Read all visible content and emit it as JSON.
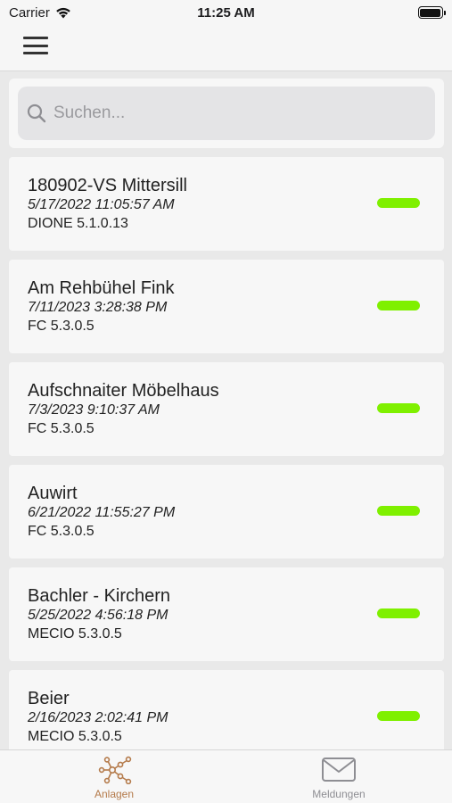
{
  "status_bar": {
    "carrier": "Carrier",
    "time": "11:25 AM"
  },
  "search": {
    "placeholder": "Suchen..."
  },
  "items": [
    {
      "name": "180902-VS Mittersill",
      "date": "5/17/2022 11:05:57 AM",
      "version": "DIONE 5.1.0.13",
      "status_color": "#7ff000"
    },
    {
      "name": "Am Rehbühel Fink",
      "date": "7/11/2023 3:28:38 PM",
      "version": "FC 5.3.0.5",
      "status_color": "#7ff000"
    },
    {
      "name": "Aufschnaiter Möbelhaus",
      "date": "7/3/2023 9:10:37 AM",
      "version": "FC 5.3.0.5",
      "status_color": "#7ff000"
    },
    {
      "name": "Auwirt",
      "date": "6/21/2022 11:55:27 PM",
      "version": "FC 5.3.0.5",
      "status_color": "#7ff000"
    },
    {
      "name": "Bachler - Kirchern",
      "date": "5/25/2022 4:56:18 PM",
      "version": "MECIO 5.3.0.5",
      "status_color": "#7ff000"
    },
    {
      "name": "Beier",
      "date": "2/16/2023 2:02:41 PM",
      "version": "MECIO 5.3.0.5",
      "status_color": "#7ff000"
    }
  ],
  "tabs": {
    "anlagen": {
      "label": "Anlagen",
      "icon": "network-icon",
      "color": "#b47a4a",
      "active": true
    },
    "meldungen": {
      "label": "Meldungen",
      "icon": "envelope-icon",
      "color": "#8e8e93",
      "active": false
    }
  }
}
